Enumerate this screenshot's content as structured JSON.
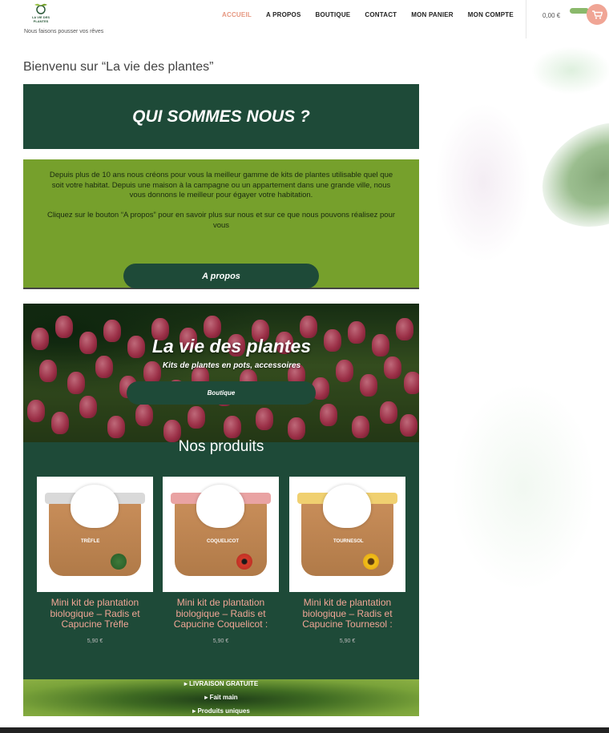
{
  "header": {
    "tagline": "Nous faisons pousser vos rêves",
    "logo_text": "LA VIE DES PLANTES",
    "nav": [
      "ACCUEIL",
      "A PROPOS",
      "BOUTIQUE",
      "CONTACT",
      "MON PANIER",
      "MON COMPTE"
    ],
    "active_nav": "ACCUEIL",
    "cart_total": "0,00 €",
    "cart_icon": "shopping-cart-icon"
  },
  "welcome_title": "Bienvenu sur “La vie des plantes”",
  "about": {
    "heading": "QUI SOMMES NOUS ?",
    "paragraph1": "Depuis plus de 10 ans nous créons pour vous la meilleur gamme de kits de plantes utilisable quel que soit votre habitat. Depuis une maison à la campagne ou un appartement dans une grande ville, nous vous donnons le meilleur pour égayer votre habitation.",
    "paragraph2": "Cliquez sur le bouton “A propos” pour en savoir plus sur nous et sur ce que nous pouvons réalisez pour vous",
    "button": "A propos"
  },
  "hero": {
    "title": "La vie des plantes",
    "subtitle": "Kits de plantes en pots, accessoires",
    "button": "Boutique"
  },
  "products": {
    "title": "Nos produits",
    "items": [
      {
        "name": "Mini kit de plantation biologique – Radis et Capucine Trèfle",
        "price": "5,90 €",
        "pot_label": "TRÈFLE",
        "accent": "#7a2a3a"
      },
      {
        "name": "Mini kit de plantation biologique – Radis et Capucine Coquelicot :",
        "price": "5,90 €",
        "pot_label": "COQUELICOT",
        "accent": "#c23a3a"
      },
      {
        "name": "Mini kit de plantation biologique – Radis et Capucine Tournesol :",
        "price": "5,90 €",
        "pot_label": "TOURNESOL",
        "accent": "#e0b020"
      }
    ]
  },
  "features": [
    "LIVRAISON GRATUITE",
    "Fait main",
    "Produits uniques"
  ]
}
